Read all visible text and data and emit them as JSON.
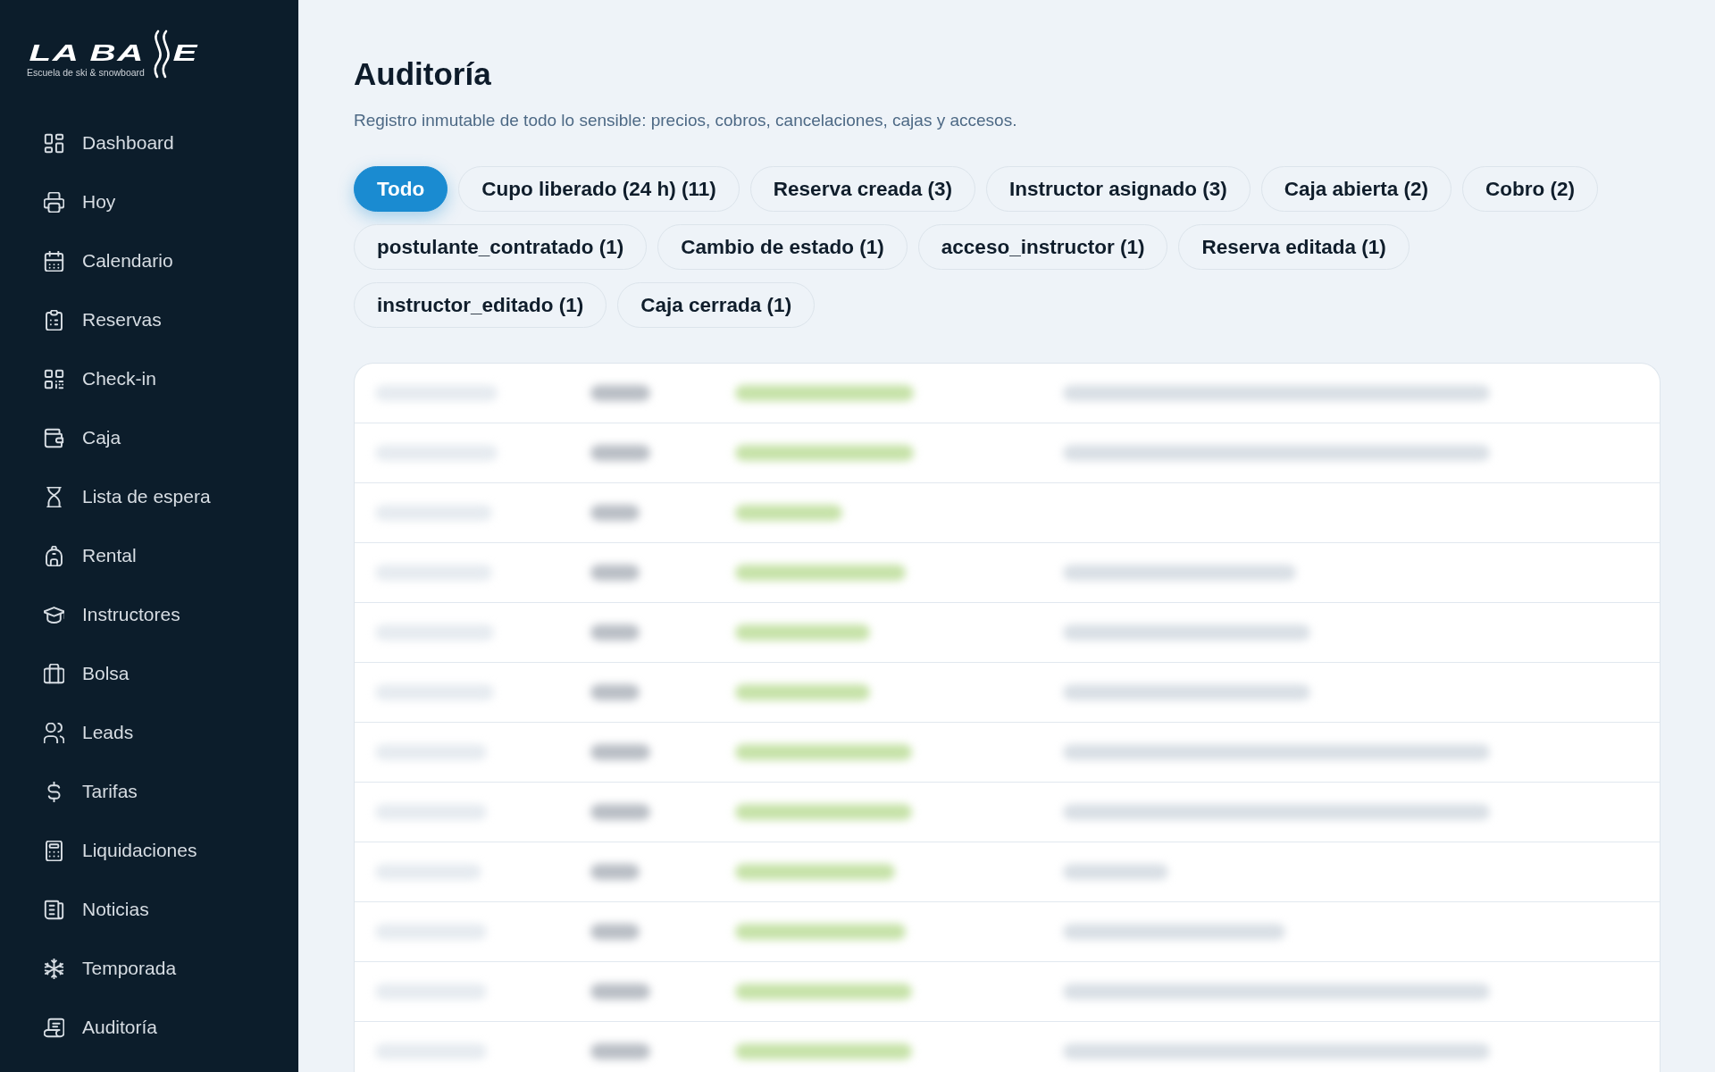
{
  "sidebar": {
    "logo": {
      "wordmark_start": "LA BA",
      "wordmark_end": "E",
      "tagline": "Escuela de ski & snowboard"
    },
    "items": [
      "Dashboard",
      "Hoy",
      "Calendario",
      "Reservas",
      "Check-in",
      "Caja",
      "Lista de espera",
      "Rental",
      "Instructores",
      "Bolsa",
      "Leads",
      "Tarifas",
      "Liquidaciones",
      "Noticias",
      "Temporada",
      "Auditoría"
    ]
  },
  "page": {
    "title": "Auditoría",
    "subtitle": "Registro inmutable de todo lo sensible: precios, cobros, cancelaciones, cajas y accesos."
  },
  "filters": [
    {
      "label": "Todo",
      "selected": true
    },
    {
      "label": "Cupo liberado (24 h) (11)",
      "selected": false
    },
    {
      "label": "Reserva creada (3)",
      "selected": false
    },
    {
      "label": "Instructor asignado (3)",
      "selected": false
    },
    {
      "label": "Caja abierta (2)",
      "selected": false
    },
    {
      "label": "Cobro (2)",
      "selected": false
    },
    {
      "label": "postulante_contratado (1)",
      "selected": false
    },
    {
      "label": "Cambio de estado (1)",
      "selected": false
    },
    {
      "label": "acceso_instructor (1)",
      "selected": false
    },
    {
      "label": "Reserva editada (1)",
      "selected": false
    },
    {
      "label": "instructor_editado (1)",
      "selected": false
    },
    {
      "label": "Caja cerrada (1)",
      "selected": false
    }
  ]
}
